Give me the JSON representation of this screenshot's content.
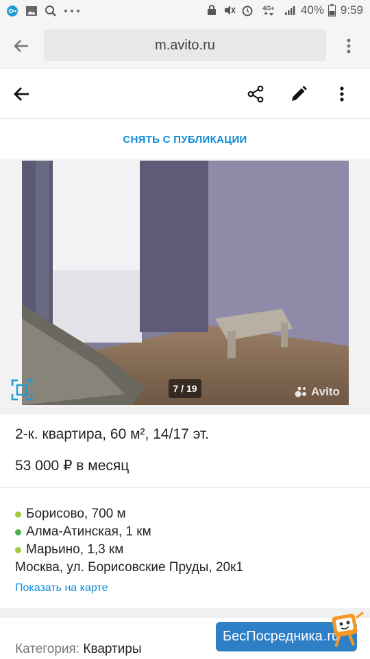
{
  "status_bar": {
    "battery": "40%",
    "time": "9:59",
    "network": "4G+"
  },
  "browser": {
    "url": "m.avito.ru"
  },
  "toolbar": {
    "back": "back-arrow",
    "share": "share-icon",
    "edit": "edit-icon",
    "more": "more-icon"
  },
  "unpublish_label": "СНЯТЬ С ПУБЛИКАЦИИ",
  "gallery": {
    "counter": "7 / 19",
    "watermark": "Avito"
  },
  "listing": {
    "title": "2-к. квартира, 60 м², 14/17 эт.",
    "price": "53 000 ₽ в месяц"
  },
  "location": {
    "metro": [
      {
        "name": "Борисово, 700 м",
        "color": "#a4c93c"
      },
      {
        "name": "Алма-Атинская, 1 км",
        "color": "#4caf50"
      },
      {
        "name": "Марьино, 1,3 км",
        "color": "#a4c93c"
      }
    ],
    "address": "Москва, ул. Борисовские Пруды, 20к1",
    "map_link": "Показать на карте"
  },
  "category": {
    "label": "Категория:",
    "value": "Квартиры"
  },
  "banner": {
    "text": "БесПосредника",
    "suffix": ".ru"
  },
  "colors": {
    "accent": "#0a8bd8",
    "banner": "#2e7fc6"
  }
}
